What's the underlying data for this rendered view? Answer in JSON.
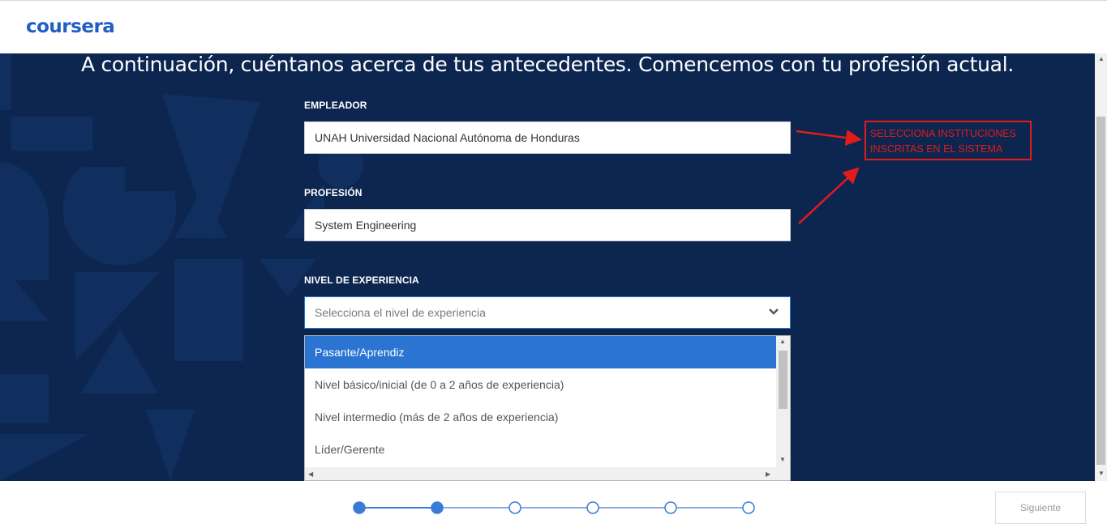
{
  "header": {
    "logo_text": "coursera"
  },
  "main": {
    "heading": "A continuación, cuéntanos acerca de tus antecedentes. Comencemos con tu profesión actual.",
    "employer": {
      "label": "EMPLEADOR",
      "value": "UNAH Universidad Nacional Autónoma de Honduras"
    },
    "profession": {
      "label": "PROFESIÓN",
      "value": "System Engineering"
    },
    "experience": {
      "label": "NIVEL DE EXPERIENCIA",
      "placeholder": "Selecciona el nivel de experiencia",
      "options": [
        "Pasante/Aprendiz",
        "Nivel básico/inicial (de 0 a 2 años de experiencia)",
        "Nivel intermedio (más de 2 años de experiencia)",
        "Líder/Gerente"
      ],
      "highlighted_option": "Pasante/Aprendiz"
    }
  },
  "annotation": {
    "line1": "SELECCIONA INSTITUCIONES",
    "line2": "INSCRITAS EN EL SISTEMA",
    "color": "#e21b1b"
  },
  "footer": {
    "next_label": "Siguiente",
    "steps_total": 6,
    "steps_completed": 2
  },
  "colors": {
    "brand": "#1f5fc4",
    "background": "#0c2650",
    "selected_option": "#2b74d1"
  }
}
